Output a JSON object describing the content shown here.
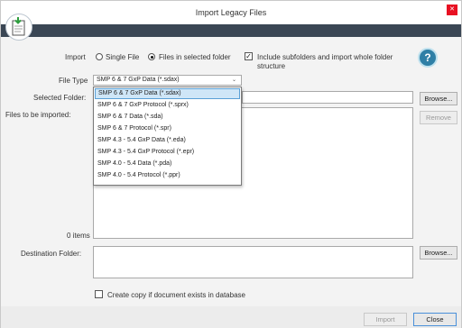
{
  "window": {
    "title": "Import Legacy Files"
  },
  "import": {
    "label": "Import",
    "options": [
      "Single File",
      "Files in selected folder"
    ],
    "selected_option": "Files in selected folder",
    "include_subfolders_label_line1": "Include subfolders and import whole folder",
    "include_subfolders_label_line2": "structure",
    "include_subfolders_checked": true
  },
  "file_type": {
    "label": "File Type",
    "value": "SMP 6 & 7 GxP Data (*.sdax)",
    "options": [
      "SMP 6 & 7 GxP Data (*.sdax)",
      "SMP 6 & 7 GxP Protocol (*.sprx)",
      "SMP 6 & 7 Data (*.sda)",
      "SMP 6 & 7 Protocol (*.spr)",
      "SMP 4.3 - 5.4 GxP Data (*.eda)",
      "SMP 4.3 - 5.4 GxP Protocol (*.epr)",
      "SMP 4.0 - 5.4 Data (*.pda)",
      "SMP 4.0 - 5.4 Protocol (*.ppr)"
    ]
  },
  "selected_folder": {
    "label": "Selected Folder:",
    "value": "",
    "browse_label": "Browse..."
  },
  "files": {
    "label": "Files to be imported:",
    "count_label": "0 items",
    "remove_label": "Remove"
  },
  "destination": {
    "label": "Destination Folder:",
    "value": "",
    "browse_label": "Browse..."
  },
  "copy_option": {
    "label": "Create copy if document exists in database",
    "checked": false
  },
  "footer": {
    "import_label": "Import",
    "close_label": "Close"
  },
  "colors": {
    "header_bar": "#3a4654",
    "highlight": "#cfe6f7",
    "close_button": "#e81123",
    "help_button": "#2f7fa6"
  }
}
